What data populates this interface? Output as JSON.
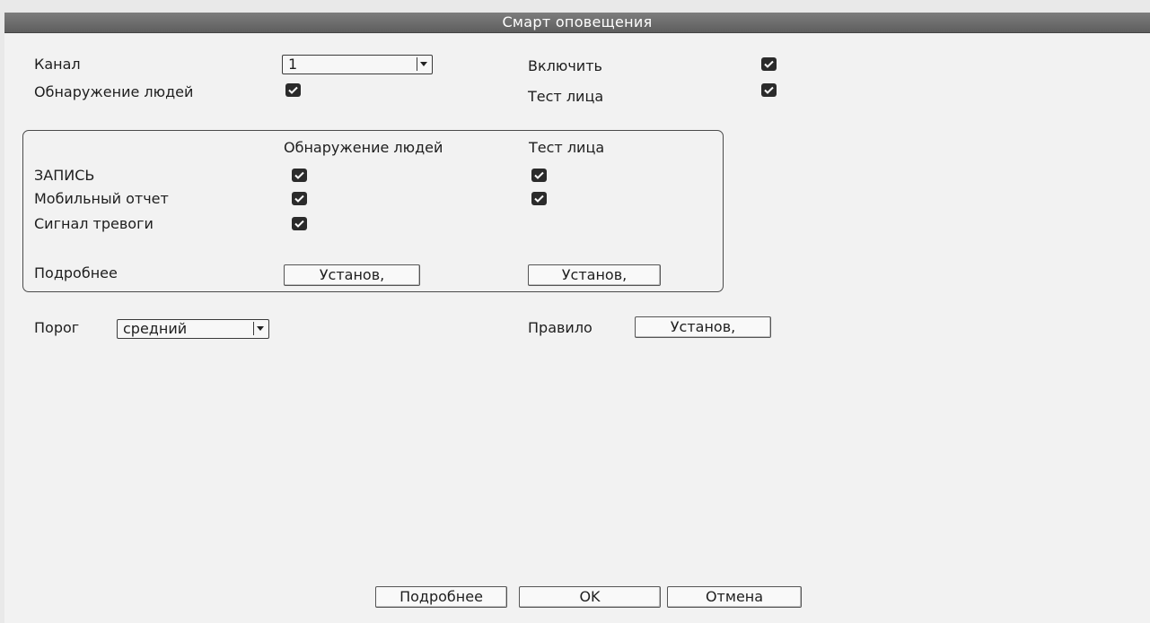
{
  "window": {
    "title": "Смарт оповещения"
  },
  "channel": {
    "label": "Канал",
    "value": "1"
  },
  "enable": {
    "label": "Включить",
    "checked": true
  },
  "people_detection": {
    "label": "Обнаружение людей",
    "checked": true
  },
  "face_test": {
    "label": "Тест лица",
    "checked": true
  },
  "actions": {
    "column_headers": [
      "Обнаружение людей",
      "Тест лица"
    ],
    "rows": [
      {
        "label": "ЗАПИСЬ",
        "people": true,
        "face": true
      },
      {
        "label": "Мобильный отчет",
        "people": true,
        "face": true
      },
      {
        "label": "Сигнал тревоги",
        "people": true
      }
    ],
    "more": {
      "label": "Подробнее",
      "people_button": "Установ,",
      "face_button": "Установ,"
    }
  },
  "threshold": {
    "label": "Порог",
    "value": "средний"
  },
  "rule": {
    "label": "Правило",
    "button": "Установ,"
  },
  "footer": {
    "more": "Подробнее",
    "ok": "OK",
    "cancel": "Отмена"
  }
}
